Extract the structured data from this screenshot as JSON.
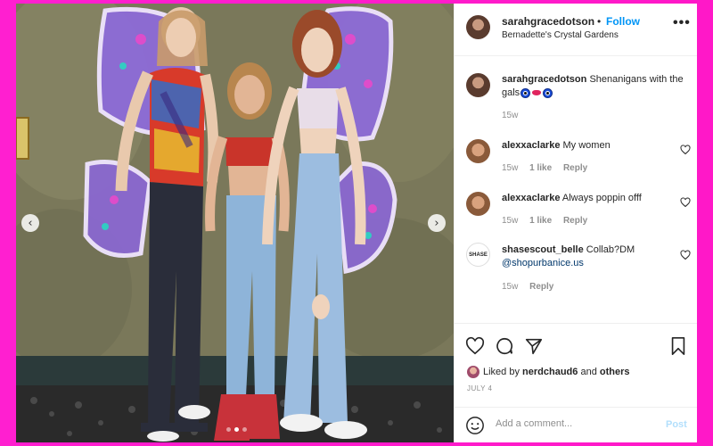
{
  "post": {
    "username": "sarahgracedotson",
    "separator": "•",
    "follow_label": "Follow",
    "location": "Bernadette's Crystal Gardens",
    "more_icon": "more-horizontal-icon"
  },
  "caption": {
    "username": "sarahgracedotson",
    "text": "Shenanigans with the gals",
    "emojis": [
      "eye-emoji",
      "lips-emoji",
      "eye-emoji"
    ],
    "age": "15w"
  },
  "comments": [
    {
      "username": "alexxaclarke",
      "text": "My women",
      "age": "15w",
      "likes": "1 like",
      "reply": "Reply"
    },
    {
      "username": "alexxaclarke",
      "text": "Always poppin offf",
      "age": "15w",
      "likes": "1 like",
      "reply": "Reply"
    },
    {
      "username": "shasescout_belle",
      "text": "Collab?DM",
      "mention": "@shopurbanice.us",
      "age": "15w",
      "reply": "Reply",
      "avatar_text": "SHASE"
    }
  ],
  "actions": {
    "liked_by_prefix": "Liked by",
    "liked_by_user": "nerdchaud6",
    "liked_by_and": "and",
    "liked_by_others": "others",
    "date": "JULY 4"
  },
  "add_comment": {
    "placeholder": "Add a comment...",
    "post_label": "Post"
  },
  "carousel": {
    "prev_glyph": "‹",
    "next_glyph": "›",
    "slides": 3,
    "active_index": 1
  },
  "colors": {
    "background": "#ff1fd0",
    "link": "#0095f6",
    "post_disabled": "#b2dffc",
    "muted": "#8e8e8e"
  }
}
